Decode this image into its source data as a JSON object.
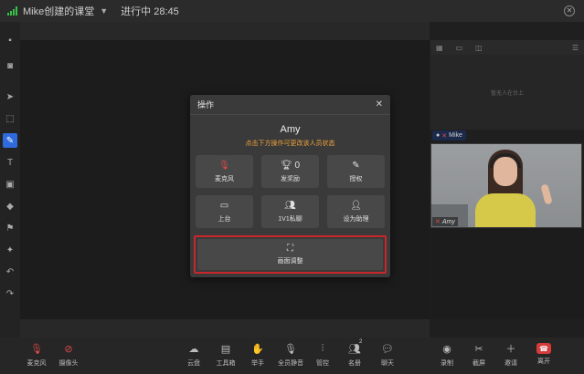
{
  "titlebar": {
    "course_name": "Mike创建的课堂",
    "status": "进行中 28:45"
  },
  "right_panel": {
    "empty_text": "暂无人在台上",
    "teacher_name": "Mike",
    "student_name": "Amy"
  },
  "modal": {
    "title": "操作",
    "user_name": "Amy",
    "hint": "点击下方操作可更改该人员状态",
    "ops": [
      {
        "label": "麦克风",
        "icon": "mic-muted-icon"
      },
      {
        "label": "发奖励",
        "extra": "0",
        "icon": "trophy-icon"
      },
      {
        "label": "授权",
        "icon": "pen-icon"
      },
      {
        "label": "上台",
        "icon": "stage-icon"
      },
      {
        "label": "1V1私聊",
        "icon": "private-chat-icon"
      },
      {
        "label": "设为助理",
        "icon": "assistant-icon"
      }
    ],
    "wide_op": {
      "label": "画面调整",
      "icon": "screen-adjust-icon"
    }
  },
  "controls": [
    {
      "label": "麦克风",
      "icon": "mic-muted-icon"
    },
    {
      "label": "摄像头",
      "icon": "camera-off-icon"
    },
    {
      "label": "云盘",
      "icon": "cloud-icon"
    },
    {
      "label": "工具箱",
      "icon": "toolbox-icon"
    },
    {
      "label": "举手",
      "icon": "raise-hand-icon"
    },
    {
      "label": "全员静音",
      "icon": "mute-all-icon"
    },
    {
      "label": "管控",
      "icon": "control-icon"
    },
    {
      "label": "名册",
      "icon": "roster-icon",
      "badge": "2"
    },
    {
      "label": "聊天",
      "icon": "chat-icon"
    },
    {
      "label": "录制",
      "icon": "record-icon"
    },
    {
      "label": "截屏",
      "icon": "screenshot-icon"
    },
    {
      "label": "邀请",
      "icon": "invite-icon"
    },
    {
      "label": "离开",
      "icon": "leave-icon"
    }
  ],
  "colors": {
    "accent": "#2f6bdc",
    "danger": "#e04848",
    "hint": "#f0a33a",
    "highlight_border": "#c8262a"
  }
}
